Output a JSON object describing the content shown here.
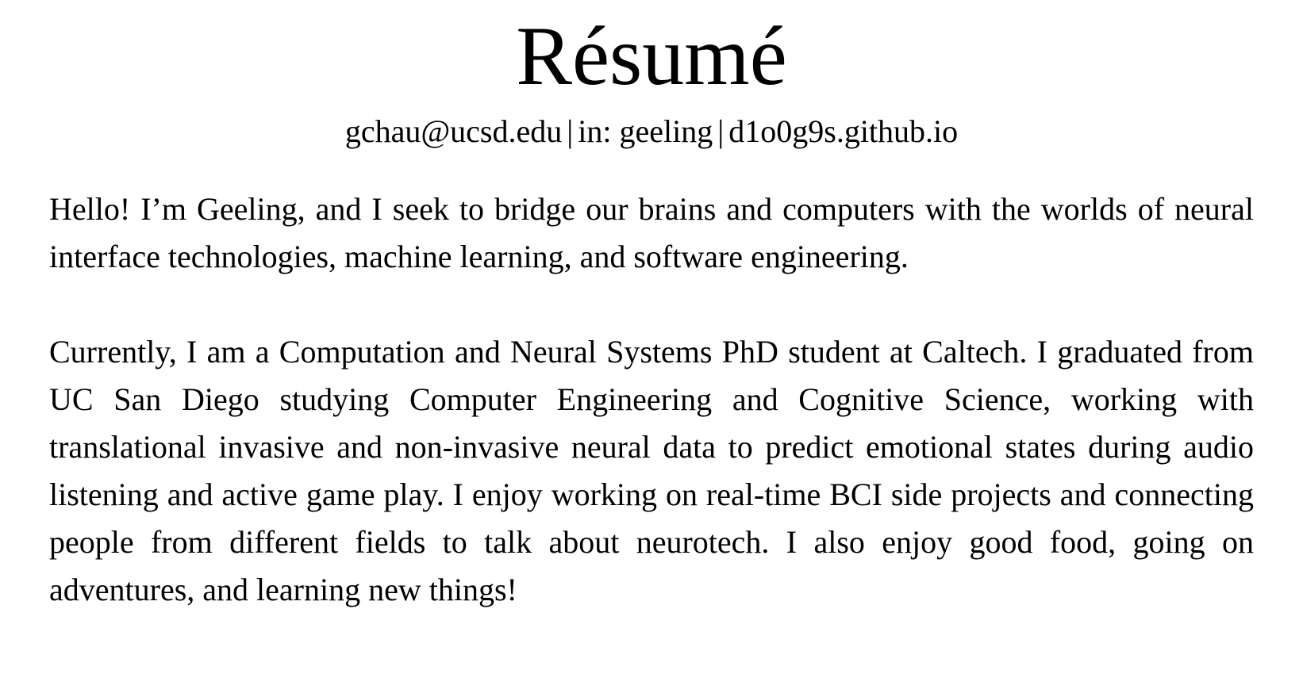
{
  "page": {
    "title": "Résumé"
  },
  "contact": {
    "email": "gchau@ucsd.edu",
    "linkedin": "in: geeling",
    "website": "d1o0g9s.github.io",
    "separator": "|"
  },
  "about": {
    "intro": "Hello!  I’m Geeling, and I seek to bridge our brains and computers with the worlds of neural interface technologies, machine learning, and software engineering.",
    "current": "Currently, I am a Computation and Neural Systems PhD student at Caltech. I graduated from UC San Diego studying Computer Engineering and Cognitive Science, working with translational invasive and non-invasive neural data to predict emotional states during audio listening and active game play. I enjoy working on real-time BCI side projects and connecting people from different fields to talk about neurotech. I also enjoy good food, going on adventures, and learning new things!"
  }
}
